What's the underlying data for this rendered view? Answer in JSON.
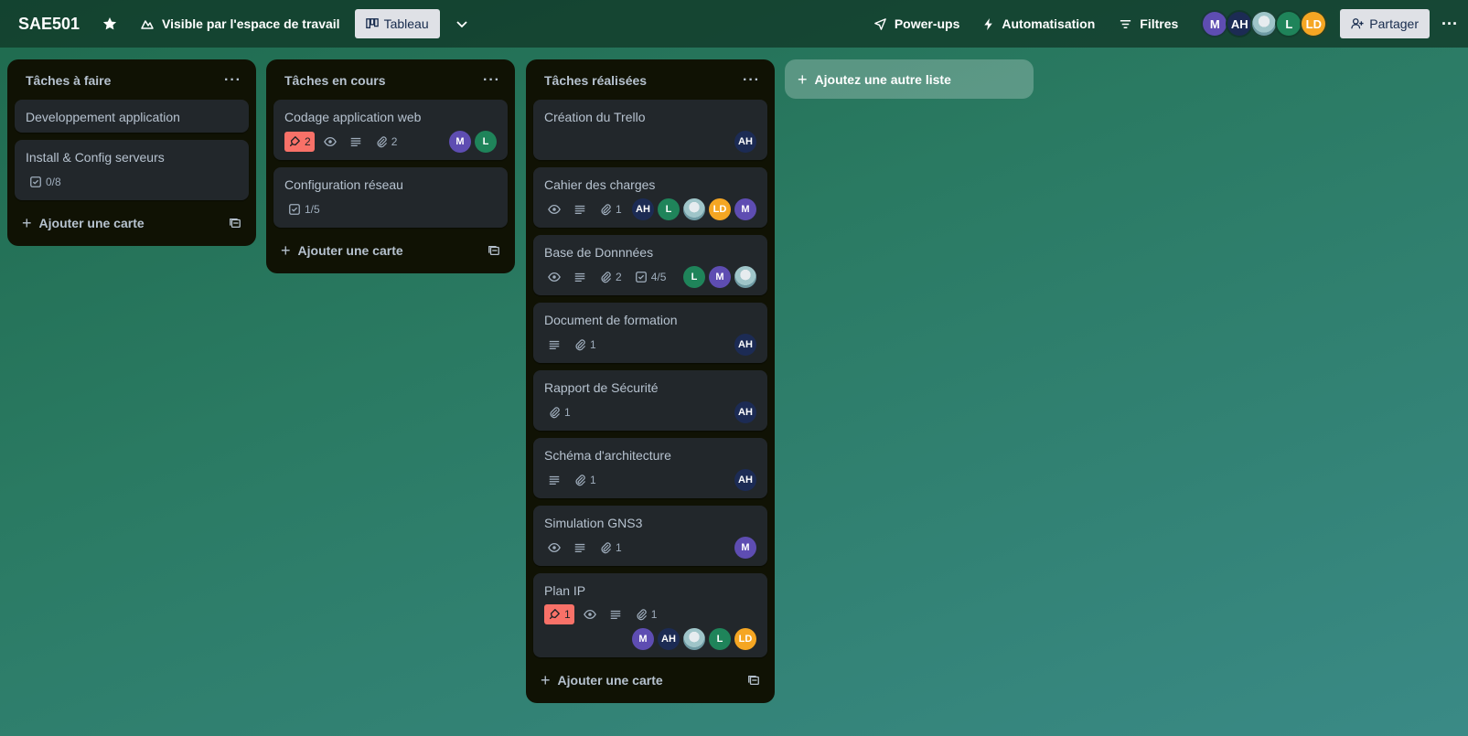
{
  "header": {
    "board_title": "SAE501",
    "visibility_label": "Visible par l'espace de travail",
    "view_label": "Tableau",
    "powerups_label": "Power-ups",
    "automation_label": "Automatisation",
    "filters_label": "Filtres",
    "share_label": "Partager",
    "members": [
      {
        "initials": "M",
        "color": "#5e4db2"
      },
      {
        "initials": "AH",
        "color": "#1c2b54"
      },
      {
        "initials": "",
        "color": "image"
      },
      {
        "initials": "L",
        "color": "#1f845a"
      },
      {
        "initials": "LD",
        "color": "#f5a623"
      }
    ]
  },
  "lists": [
    {
      "title": "Tâches à faire",
      "add_card_label": "Ajouter une carte",
      "cards": [
        {
          "title": "Developpement application"
        },
        {
          "title": "Install & Config serveurs",
          "checklist": "0/8"
        }
      ]
    },
    {
      "title": "Tâches en cours",
      "add_card_label": "Ajouter une carte",
      "cards": [
        {
          "title": "Codage application web",
          "notifications": "2",
          "attachments": "2",
          "members": [
            "M",
            "L"
          ]
        },
        {
          "title": "Configuration réseau",
          "checklist": "1/5"
        }
      ]
    },
    {
      "title": "Tâches réalisées",
      "add_card_label": "Ajouter une carte",
      "cards": [
        {
          "title": "Création du Trello",
          "members": [
            "AH"
          ]
        },
        {
          "title": "Cahier des charges",
          "attachments": "1",
          "members": [
            "AH",
            "L",
            "img",
            "LD",
            "M"
          ]
        },
        {
          "title": "Base de Donnnées",
          "attachments": "2",
          "checklist": "4/5",
          "members": [
            "L",
            "M",
            "img"
          ]
        },
        {
          "title": "Document de formation",
          "attachments": "1",
          "members": [
            "AH"
          ]
        },
        {
          "title": "Rapport de Sécurité",
          "attachments": "1",
          "members": [
            "AH"
          ]
        },
        {
          "title": "Schéma d'architecture",
          "attachments": "1",
          "members": [
            "AH"
          ]
        },
        {
          "title": "Simulation GNS3",
          "attachments": "1",
          "members": [
            "M"
          ]
        },
        {
          "title": "Plan IP",
          "notifications": "1",
          "attachments": "1",
          "members": [
            "M",
            "AH",
            "img",
            "L",
            "LD"
          ]
        }
      ]
    }
  ],
  "add_list_label": "Ajoutez une autre liste"
}
